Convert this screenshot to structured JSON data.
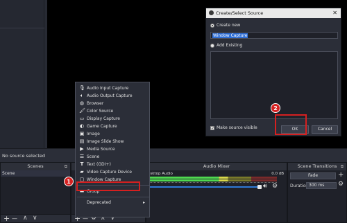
{
  "source_bar": {
    "label": "No source selected"
  },
  "docks": {
    "scenes": {
      "title": "Scenes",
      "items": [
        "Scene"
      ]
    },
    "sources": {
      "title": ""
    },
    "mixer": {
      "title": "Audio Mixer",
      "channel": "esktop Audio",
      "db": "0.0 dB"
    },
    "transitions": {
      "title": "Scene Transitions",
      "type": "Fade",
      "duration_label": "Duration",
      "duration_value": "300 ms"
    }
  },
  "context_menu": {
    "items": [
      {
        "label": "Audio Input Capture",
        "icon": "microphone-icon"
      },
      {
        "label": "Audio Output Capture",
        "icon": "speaker-icon"
      },
      {
        "label": "Browser",
        "icon": "globe-icon"
      },
      {
        "label": "Color Source",
        "icon": "paint-brush-icon"
      },
      {
        "label": "Display Capture",
        "icon": "monitor-icon"
      },
      {
        "label": "Game Capture",
        "icon": "gamepad-icon"
      },
      {
        "label": "Image",
        "icon": "image-icon"
      },
      {
        "label": "Image Slide Show",
        "icon": "slideshow-icon"
      },
      {
        "label": "Media Source",
        "icon": "play-icon"
      },
      {
        "label": "Scene",
        "icon": "list-icon"
      },
      {
        "label": "Text (GDI+)",
        "icon": "text-icon"
      },
      {
        "label": "Video Capture Device",
        "icon": "camera-icon"
      },
      {
        "label": "Window Capture",
        "icon": "window-icon"
      },
      {
        "label": "Group",
        "icon": "folder-icon"
      },
      {
        "label": "Deprecated",
        "icon": "",
        "submenu": true
      }
    ]
  },
  "dialog": {
    "title": "Create/Select Source",
    "create_new_label": "Create new",
    "name_value": "Window Capture",
    "add_existing_label": "Add Existing",
    "make_visible_label": "Make source visible",
    "ok_label": "OK",
    "cancel_label": "Cancel"
  },
  "annotations": {
    "step1": "1",
    "step2": "2",
    "highlight_color": "#d62020"
  },
  "toolbar_glyphs": {
    "add": "+",
    "remove": "—",
    "up": "∧",
    "down": "∨",
    "gear": "⚙"
  }
}
